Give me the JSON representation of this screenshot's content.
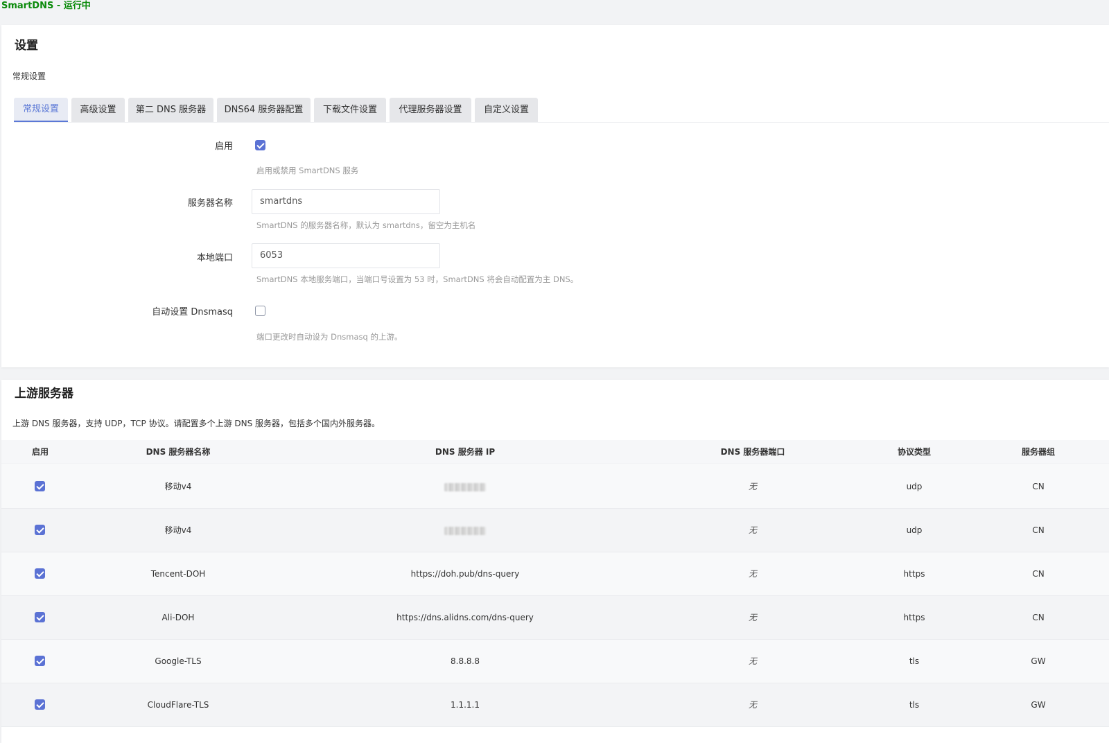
{
  "status": {
    "text": "SmartDNS - 运行中",
    "color": "#0a8a0a"
  },
  "settings": {
    "title": "设置",
    "subtitle": "常规设置",
    "tabs": [
      "常规设置",
      "高级设置",
      "第二 DNS 服务器",
      "DNS64 服务器配置",
      "下载文件设置",
      "代理服务器设置",
      "自定义设置"
    ],
    "active_tab": "常规设置",
    "enable": {
      "label": "启用",
      "checked": true,
      "hint": "启用或禁用 SmartDNS 服务"
    },
    "server_name": {
      "label": "服务器名称",
      "value": "smartdns",
      "hint": "SmartDNS 的服务器名称，默认为 smartdns，留空为主机名"
    },
    "local_port": {
      "label": "本地端口",
      "value": "6053",
      "hint": "SmartDNS 本地服务端口，当端口号设置为 53 时，SmartDNS 将会自动配置为主 DNS。"
    },
    "auto_dnsmasq": {
      "label": "自动设置 Dnsmasq",
      "checked": false,
      "hint": "端口更改时自动设为 Dnsmasq 的上游。"
    }
  },
  "upstream": {
    "title": "上游服务器",
    "description": "上游 DNS 服务器，支持 UDP，TCP 协议。请配置多个上游 DNS 服务器，包括多个国内外服务器。",
    "columns": [
      "启用",
      "DNS 服务器名称",
      "DNS 服务器 IP",
      "DNS 服务器端口",
      "协议类型",
      "服务器组"
    ],
    "rows": [
      {
        "enabled": true,
        "name": "移动v4",
        "ip": "",
        "ip_blurred": true,
        "port": "无",
        "protocol": "udp",
        "group": "CN"
      },
      {
        "enabled": true,
        "name": "移动v4",
        "ip": "",
        "ip_blurred": true,
        "port": "无",
        "protocol": "udp",
        "group": "CN"
      },
      {
        "enabled": true,
        "name": "Tencent-DOH",
        "ip": "https://doh.pub/dns-query",
        "ip_blurred": false,
        "port": "无",
        "protocol": "https",
        "group": "CN"
      },
      {
        "enabled": true,
        "name": "Ali-DOH",
        "ip": "https://dns.alidns.com/dns-query",
        "ip_blurred": false,
        "port": "无",
        "protocol": "https",
        "group": "CN"
      },
      {
        "enabled": true,
        "name": "Google-TLS",
        "ip": "8.8.8.8",
        "ip_blurred": false,
        "port": "无",
        "protocol": "tls",
        "group": "GW"
      },
      {
        "enabled": true,
        "name": "CloudFlare-TLS",
        "ip": "1.1.1.1",
        "ip_blurred": false,
        "port": "无",
        "protocol": "tls",
        "group": "GW"
      }
    ]
  },
  "colors": {
    "accent": "#5b72d4",
    "tab_active": "#5b78d6",
    "status_green": "#0a8a0a"
  }
}
